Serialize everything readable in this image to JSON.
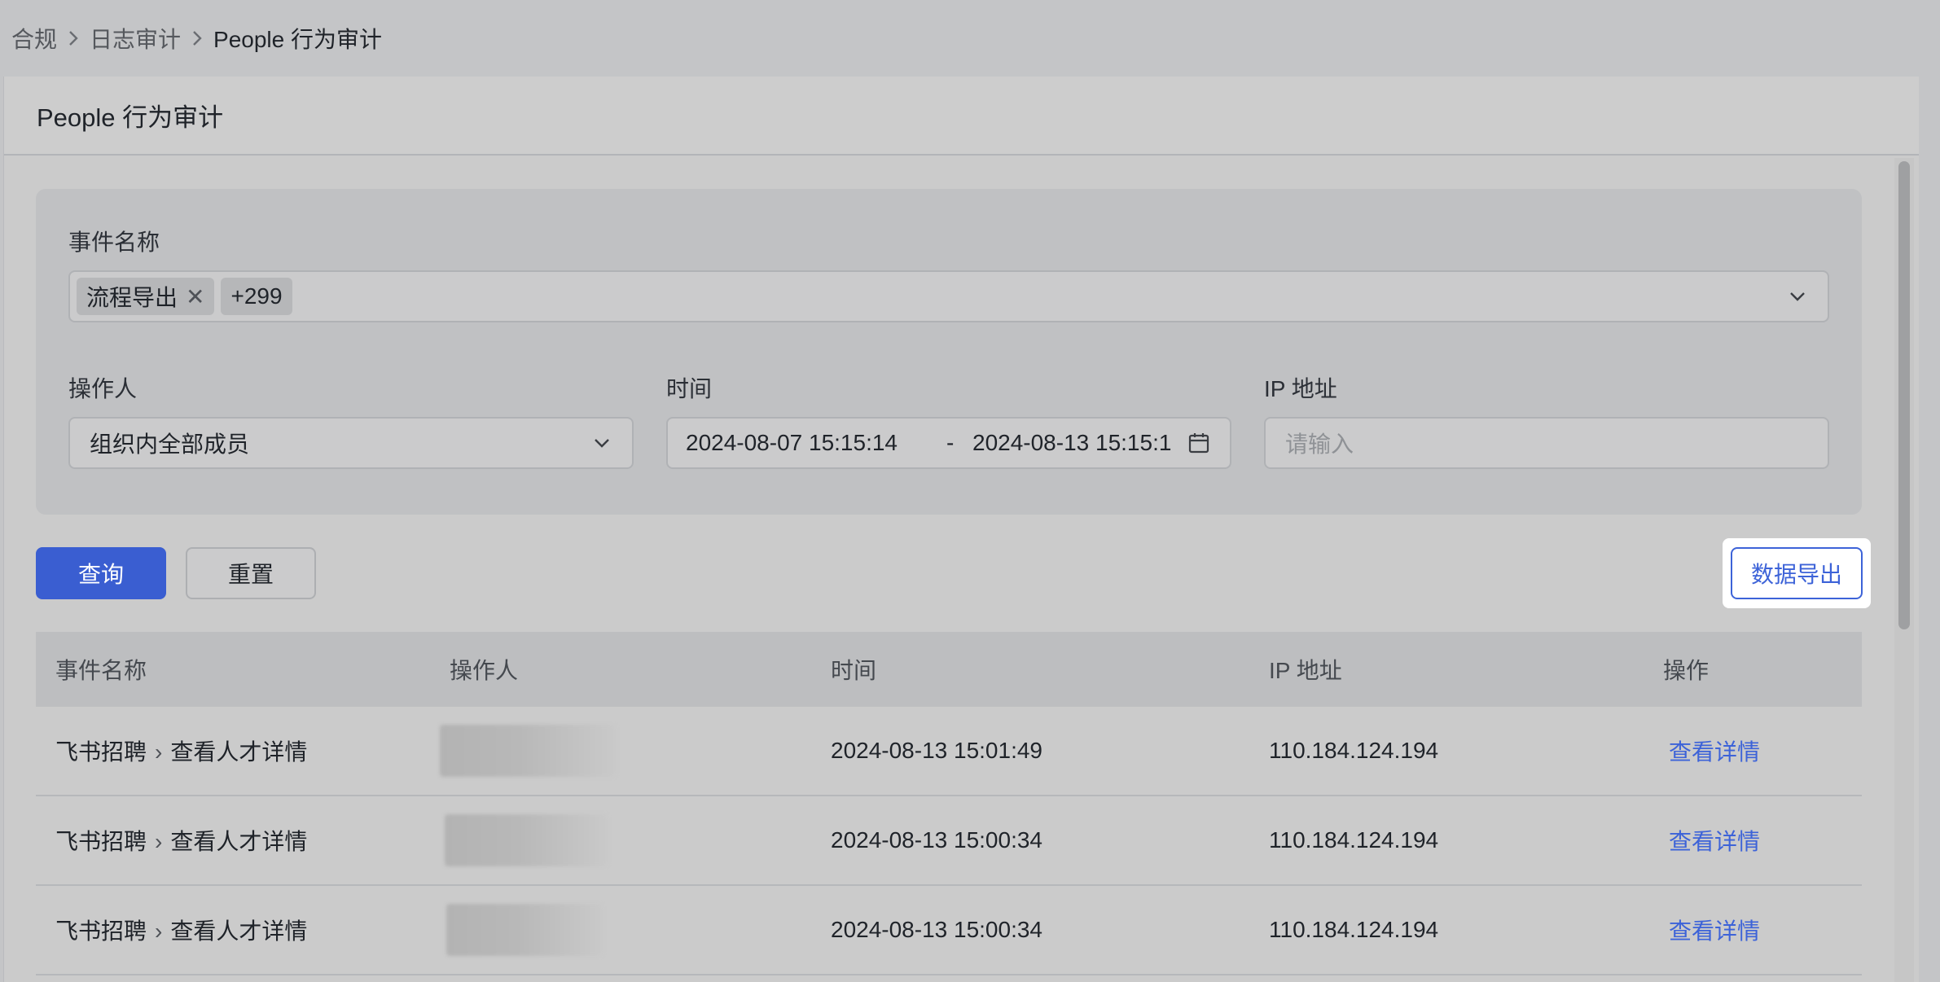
{
  "breadcrumb": {
    "items": [
      "合规",
      "日志审计",
      "People 行为审计"
    ]
  },
  "page": {
    "title": "People 行为审计"
  },
  "filters": {
    "event_name": {
      "label": "事件名称",
      "tag": "流程导出",
      "more": "+299"
    },
    "operator": {
      "label": "操作人",
      "value": "组织内全部成员"
    },
    "time": {
      "label": "时间",
      "start": "2024-08-07 15:15:14",
      "separator": "-",
      "end": "2024-08-13 15:15:1"
    },
    "ip": {
      "label": "IP 地址",
      "placeholder": "请输入"
    }
  },
  "actions": {
    "query": "查询",
    "reset": "重置",
    "export": "数据导出"
  },
  "table": {
    "headers": [
      "事件名称",
      "操作人",
      "时间",
      "IP 地址",
      "操作"
    ],
    "rows": [
      {
        "event_app": "飞书招聘",
        "event_action": "查看人才详情",
        "time": "2024-08-13 15:01:49",
        "ip": "110.184.124.194",
        "action": "查看详情"
      },
      {
        "event_app": "飞书招聘",
        "event_action": "查看人才详情",
        "time": "2024-08-13 15:00:34",
        "ip": "110.184.124.194",
        "action": "查看详情"
      },
      {
        "event_app": "飞书招聘",
        "event_action": "查看人才详情",
        "time": "2024-08-13 15:00:34",
        "ip": "110.184.124.194",
        "action": "查看详情"
      }
    ]
  },
  "colors": {
    "primary": "#3a5ed1",
    "link": "#3d63d8",
    "overlay_bg": "#c4c5c7"
  }
}
